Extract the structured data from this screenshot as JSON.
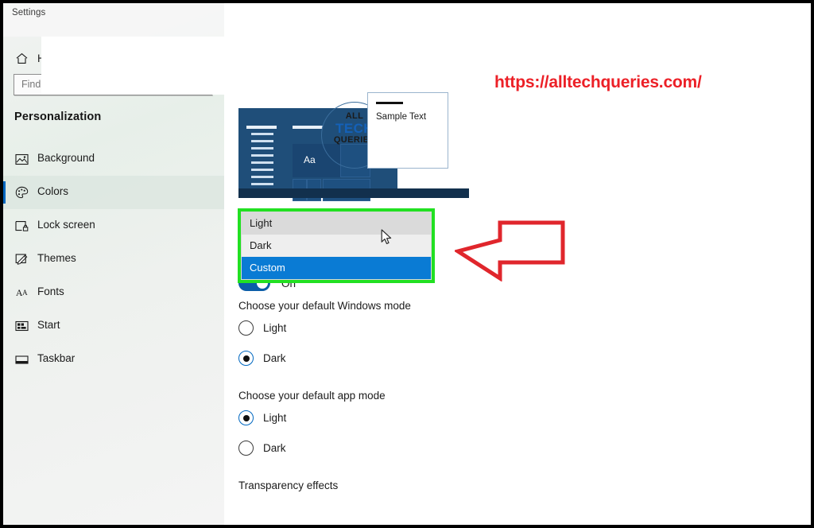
{
  "window": {
    "app_title": "Settings"
  },
  "sidebar": {
    "home": {
      "label": "Home",
      "icon": "home-icon"
    },
    "search": {
      "placeholder": "Find a setting",
      "value": ""
    },
    "section_heading": "Personalization",
    "items": [
      {
        "label": "Background",
        "icon": "image-icon",
        "selected": false
      },
      {
        "label": "Colors",
        "icon": "palette-icon",
        "selected": true
      },
      {
        "label": "Lock screen",
        "icon": "lock-screen-icon",
        "selected": false
      },
      {
        "label": "Themes",
        "icon": "themes-brush-icon",
        "selected": false
      },
      {
        "label": "Fonts",
        "icon": "fonts-aa-icon",
        "selected": false
      },
      {
        "label": "Start",
        "icon": "start-grid-icon",
        "selected": false
      },
      {
        "label": "Taskbar",
        "icon": "taskbar-icon",
        "selected": false
      }
    ]
  },
  "main": {
    "preview": {
      "tile_label": "Aa",
      "window_text": "Sample Text",
      "watermark": {
        "line1": "ALL",
        "line2": "TECH",
        "line3": "QUERIES"
      }
    },
    "theme_dropdown": {
      "options": [
        {
          "label": "Light",
          "state": "hover"
        },
        {
          "label": "Dark",
          "state": "normal"
        },
        {
          "label": "Custom",
          "state": "selected"
        }
      ],
      "highlight_color": "#22e022",
      "selected_color": "#0a7bd4"
    },
    "windows_mode": {
      "label": "Choose your default Windows mode",
      "options": [
        {
          "label": "Light",
          "checked": false
        },
        {
          "label": "Dark",
          "checked": true
        }
      ]
    },
    "app_mode": {
      "label": "Choose your default app mode",
      "options": [
        {
          "label": "Light",
          "checked": true
        },
        {
          "label": "Dark",
          "checked": false
        }
      ]
    },
    "transparency": {
      "label": "Transparency effects",
      "state": "On",
      "on": true
    }
  },
  "annotations": {
    "site_url": "https://alltechqueries.com/",
    "url_color": "#ec2027",
    "arrow_color": "#e0262c",
    "arrow_direction": "left"
  }
}
